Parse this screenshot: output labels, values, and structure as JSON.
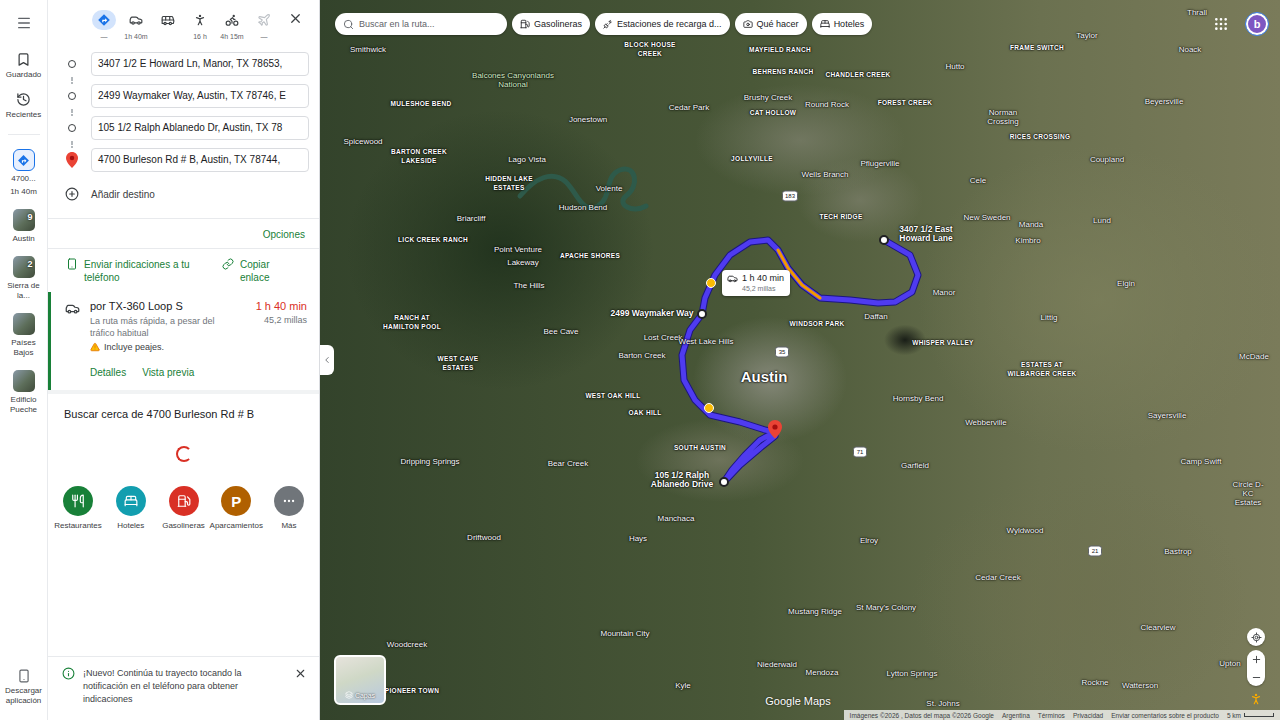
{
  "rail": {
    "nav": [
      {
        "label": "Guardado",
        "kind": "saved"
      },
      {
        "label": "Recientes",
        "kind": "recent"
      }
    ],
    "recents": [
      {
        "label": "4700...",
        "sub": "1h 40m",
        "kind": "route",
        "selected": true,
        "badge": ""
      },
      {
        "label": "Austin",
        "sub": "",
        "kind": "photo",
        "selected": false,
        "badge": "9"
      },
      {
        "label": "Sierra de la...",
        "sub": "",
        "kind": "photo",
        "selected": false,
        "badge": "2"
      },
      {
        "label": "Países Bajos",
        "sub": "",
        "kind": "photo",
        "selected": false,
        "badge": ""
      },
      {
        "label": "Edificio Pueche",
        "sub": "",
        "kind": "photo",
        "selected": false,
        "badge": ""
      }
    ],
    "download": "Descargar aplicación"
  },
  "directions": {
    "modes": [
      {
        "kind": "best",
        "label": "—",
        "selected": true,
        "disabled": false
      },
      {
        "kind": "car",
        "label": "1h 40m",
        "selected": false,
        "disabled": false
      },
      {
        "kind": "transit",
        "label": "",
        "selected": false,
        "disabled": false
      },
      {
        "kind": "walk",
        "label": "16 h",
        "selected": false,
        "disabled": false
      },
      {
        "kind": "bike",
        "label": "4h 15m",
        "selected": false,
        "disabled": false
      },
      {
        "kind": "flight",
        "label": "—",
        "selected": false,
        "disabled": true
      }
    ],
    "waypoints": [
      {
        "value": "3407 1/2 E Howard Ln, Manor, TX 78653,",
        "kind": "origin"
      },
      {
        "value": "2499 Waymaker Way, Austin, TX 78746, E",
        "kind": "stop"
      },
      {
        "value": "105 1/2 Ralph Ablanedo Dr, Austin, TX 78",
        "kind": "stop"
      },
      {
        "value": "4700 Burleson Rd # B, Austin, TX 78744,",
        "kind": "destination"
      }
    ],
    "add": "Añadir destino",
    "options": "Opciones",
    "share": [
      {
        "label": "Enviar indicaciones a tu teléfono",
        "kind": "phone"
      },
      {
        "label": "Copiar enlace",
        "kind": "link"
      }
    ],
    "routes": [
      {
        "via": "por TX-360 Loop S",
        "time": "1 h 40 min",
        "summary": "La ruta más rápida, a pesar del tráfico habitual",
        "distance": "45,2 millas",
        "warning": "Incluye peajes.",
        "links": [
          "Detalles",
          "Vista previa"
        ],
        "selected": true
      }
    ],
    "nearby": {
      "title": "Buscar cerca de 4700 Burleson Rd # B",
      "loading": true,
      "categories": [
        {
          "label": "Restaurantes",
          "kind": "food",
          "color": "#188038",
          "glyph": ""
        },
        {
          "label": "Hoteles",
          "kind": "hotel",
          "color": "#129eaf",
          "glyph": ""
        },
        {
          "label": "Gasolineras",
          "kind": "gas",
          "color": "#d93025",
          "glyph": ""
        },
        {
          "label": "Aparcamientos",
          "kind": "parking",
          "color": "#b06000",
          "glyph": "P"
        },
        {
          "label": "Más",
          "kind": "more",
          "color": "#70757a",
          "glyph": ""
        }
      ]
    },
    "banner": {
      "text": "¡Nuevo! Continúa tu trayecto tocando la notificación en el teléfono para obtener indicaciones"
    }
  },
  "map": {
    "search": {
      "placeholder": "Buscar en la ruta..."
    },
    "chips": [
      {
        "label": "Gasolineras",
        "kind": "gas"
      },
      {
        "label": "Estaciones de recarga d...",
        "kind": "charge"
      },
      {
        "label": "Qué hacer",
        "kind": "todo"
      },
      {
        "label": "Hoteles",
        "kind": "hotel"
      }
    ],
    "avatar": "b",
    "route": {
      "time": "1 h 40 min",
      "distance": "45,2 millas"
    },
    "labels": [
      {
        "text": "Smithwick",
        "kind": "town"
      },
      {
        "text": "Balcones Canyonlands National",
        "kind": "park"
      },
      {
        "text": "BLOCK HOUSE CREEK",
        "kind": "area"
      },
      {
        "text": "MAYFIELD RANCH",
        "kind": "area"
      },
      {
        "text": "Thrall",
        "kind": "town"
      },
      {
        "text": "Taylor",
        "kind": "town"
      },
      {
        "text": "FRAME SWITCH",
        "kind": "area"
      },
      {
        "text": "Noack",
        "kind": "town"
      },
      {
        "text": "BEHRENS RANCH",
        "kind": "area"
      },
      {
        "text": "CHANDLER CREEK",
        "kind": "area"
      },
      {
        "text": "Hutto",
        "kind": "town"
      },
      {
        "text": "MULESHOE BEND",
        "kind": "area"
      },
      {
        "text": "Cedar Park",
        "kind": "town"
      },
      {
        "text": "Brushy Creek",
        "kind": "town"
      },
      {
        "text": "CAT HOLLOW",
        "kind": "area"
      },
      {
        "text": "Round Rock",
        "kind": "town"
      },
      {
        "text": "FOREST CREEK",
        "kind": "area"
      },
      {
        "text": "Beyersville",
        "kind": "town"
      },
      {
        "text": "Jonestown",
        "kind": "town"
      },
      {
        "text": "Norman Crossing",
        "kind": "town"
      },
      {
        "text": "RICES CROSSING",
        "kind": "area"
      },
      {
        "text": "Spicewood",
        "kind": "town"
      },
      {
        "text": "BARTON CREEK LAKESIDE",
        "kind": "area"
      },
      {
        "text": "Lago Vista",
        "kind": "town"
      },
      {
        "text": "JOLLYVILLE",
        "kind": "area"
      },
      {
        "text": "Pflugerville",
        "kind": "town"
      },
      {
        "text": "Coupland",
        "kind": "town"
      },
      {
        "text": "Wells Branch",
        "kind": "town"
      },
      {
        "text": "Cele",
        "kind": "town"
      },
      {
        "text": "HIDDEN LAKE ESTATES",
        "kind": "area"
      },
      {
        "text": "Volente",
        "kind": "town"
      },
      {
        "text": "Hudson Bend",
        "kind": "town"
      },
      {
        "text": "TECH RIDGE",
        "kind": "area"
      },
      {
        "text": "New Sweden",
        "kind": "town"
      },
      {
        "text": "Manda",
        "kind": "town"
      },
      {
        "text": "Lund",
        "kind": "town"
      },
      {
        "text": "Briarcliff",
        "kind": "town"
      },
      {
        "text": "LICK CREEK RANCH",
        "kind": "area"
      },
      {
        "text": "Point Venture",
        "kind": "town"
      },
      {
        "text": "APACHE SHORES",
        "kind": "area"
      },
      {
        "text": "Lakeway",
        "kind": "town"
      },
      {
        "text": "Kimbro",
        "kind": "town"
      },
      {
        "text": "3407 1/2 East Howard Lane",
        "kind": "address"
      },
      {
        "text": "Elgin",
        "kind": "town"
      },
      {
        "text": "The Hills",
        "kind": "town"
      },
      {
        "text": "Manor",
        "kind": "town"
      },
      {
        "text": "2499 Waymaker Way",
        "kind": "address"
      },
      {
        "text": "Daffan",
        "kind": "town"
      },
      {
        "text": "Littig",
        "kind": "town"
      },
      {
        "text": "RANCH AT HAMILTON POOL",
        "kind": "area"
      },
      {
        "text": "WINDSOR PARK",
        "kind": "area"
      },
      {
        "text": "Bee Cave",
        "kind": "town"
      },
      {
        "text": "Lost Creek",
        "kind": "town"
      },
      {
        "text": "West Lake Hills",
        "kind": "town"
      },
      {
        "text": "WHISPER VALLEY",
        "kind": "area"
      },
      {
        "text": "Barton Creek",
        "kind": "town"
      },
      {
        "text": "McDade",
        "kind": "town"
      },
      {
        "text": "WEST CAVE ESTATES",
        "kind": "area"
      },
      {
        "text": "ESTATES AT WILBARGER CREEK",
        "kind": "area"
      },
      {
        "text": "Austin",
        "kind": "city"
      },
      {
        "text": "WEST OAK HILL",
        "kind": "area"
      },
      {
        "text": "Hornsby Bend",
        "kind": "town"
      },
      {
        "text": "OAK HILL",
        "kind": "area"
      },
      {
        "text": "Sayersville",
        "kind": "town"
      },
      {
        "text": "Webberville",
        "kind": "town"
      },
      {
        "text": "SOUTH AUSTIN",
        "kind": "area"
      },
      {
        "text": "Dripping Springs",
        "kind": "town"
      },
      {
        "text": "Bear Creek",
        "kind": "town"
      },
      {
        "text": "Garfield",
        "kind": "town"
      },
      {
        "text": "Camp Swift",
        "kind": "town"
      },
      {
        "text": "105 1/2 Ralph Ablanedo Drive",
        "kind": "address"
      },
      {
        "text": "Circle D-KC Estates",
        "kind": "town"
      },
      {
        "text": "Manchaca",
        "kind": "town"
      },
      {
        "text": "Wyldwood",
        "kind": "town"
      },
      {
        "text": "Driftwood",
        "kind": "town"
      },
      {
        "text": "Hays",
        "kind": "town"
      },
      {
        "text": "Elroy",
        "kind": "town"
      },
      {
        "text": "Bastrop",
        "kind": "town"
      },
      {
        "text": "Cedar Creek",
        "kind": "town"
      },
      {
        "text": "St Mary's Colony",
        "kind": "town"
      },
      {
        "text": "Mustang Ridge",
        "kind": "town"
      },
      {
        "text": "Clearview",
        "kind": "town"
      },
      {
        "text": "Mountain City",
        "kind": "town"
      },
      {
        "text": "Woodcreek",
        "kind": "town"
      },
      {
        "text": "Upton",
        "kind": "town"
      },
      {
        "text": "Niederwald",
        "kind": "town"
      },
      {
        "text": "Mendoza",
        "kind": "town"
      },
      {
        "text": "Lytton Springs",
        "kind": "town"
      },
      {
        "text": "Rockne",
        "kind": "town"
      },
      {
        "text": "Watterson",
        "kind": "town"
      },
      {
        "text": "Kyle",
        "kind": "town"
      },
      {
        "text": "PIONEER TOWN",
        "kind": "area"
      },
      {
        "text": "St. Johns",
        "kind": "town"
      }
    ],
    "shields": [
      "183",
      "35",
      "71",
      "21"
    ],
    "layers": "Capas",
    "logo": "Google Maps",
    "footer": [
      "Imágenes ©2026 , Datos del mapa ©2026 Google",
      "Argentina",
      "Términos",
      "Privacidad",
      "Enviar comentarios sobre el producto"
    ],
    "scale": "5 km"
  }
}
